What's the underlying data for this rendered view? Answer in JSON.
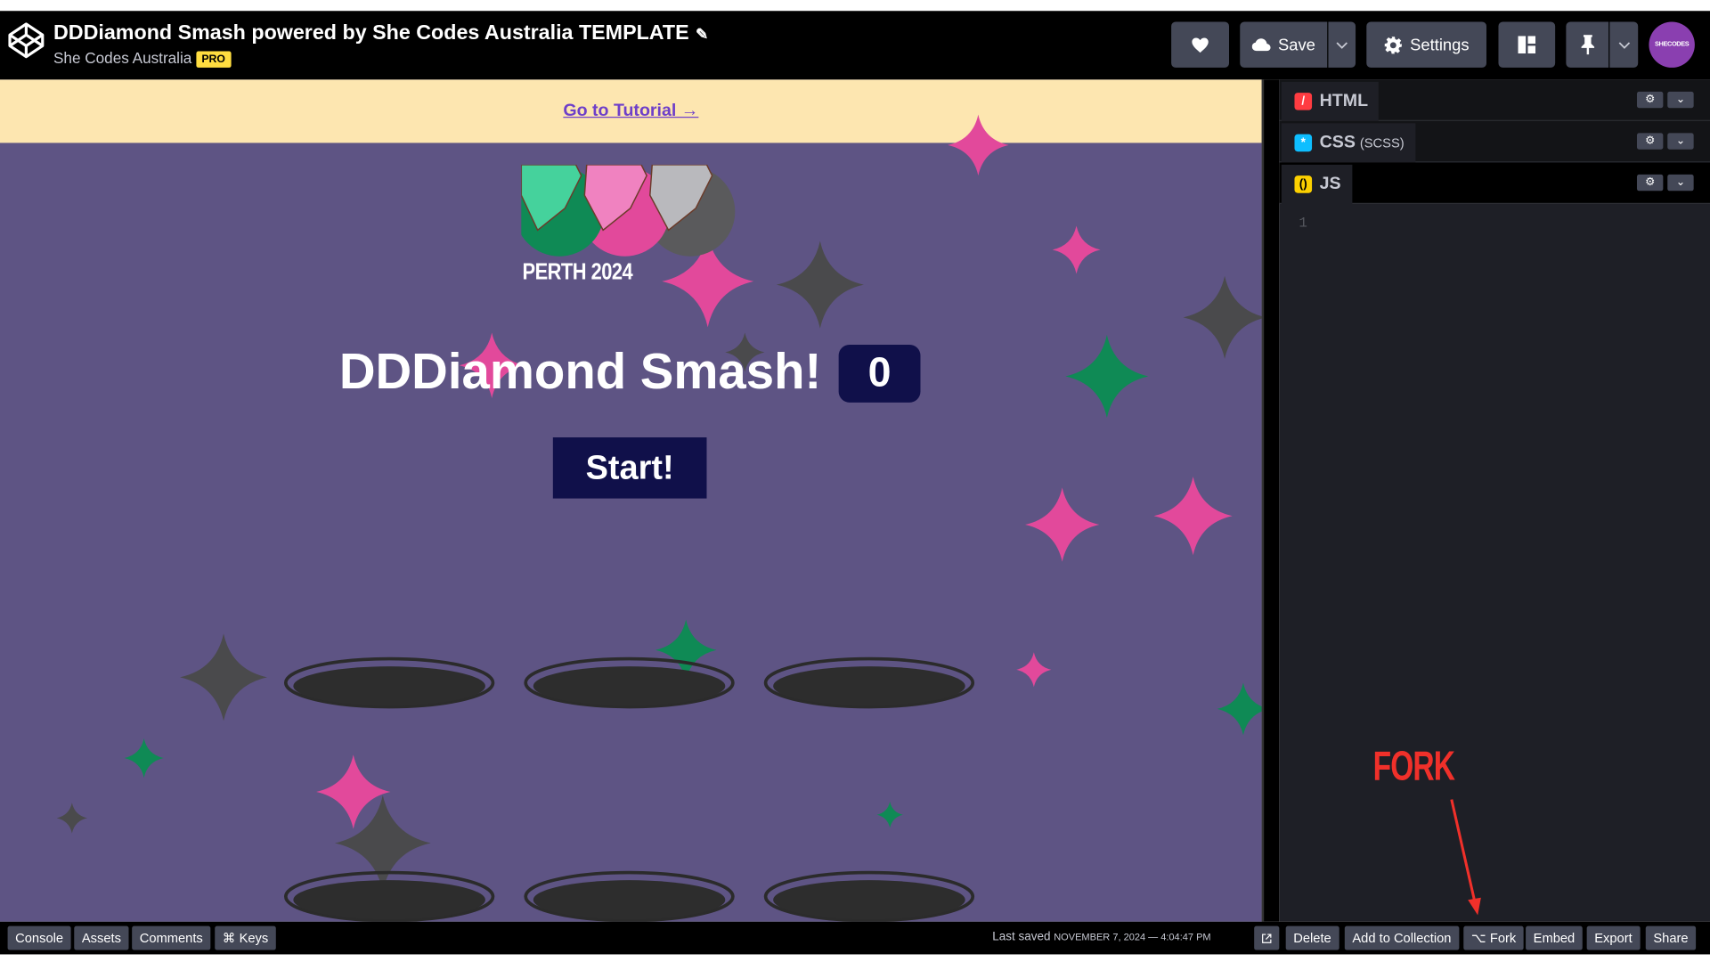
{
  "header": {
    "title": "DDDiamond Smash powered by She Codes Australia TEMPLATE",
    "owner": "She Codes Australia",
    "owner_badge": "PRO",
    "save_label": "Save",
    "settings_label": "Settings",
    "avatar_text": "SHECODES",
    "avatar_color": "#8a3fb0"
  },
  "preview": {
    "banner_link": "Go to Tutorial →",
    "event_label": "PERTH 2024",
    "game_title": "DDDiamond Smash!",
    "score": "0",
    "start_label": "Start!",
    "background_color": "#5e5484"
  },
  "editor": {
    "panes": [
      {
        "label": "HTML",
        "sublabel": "",
        "icon": "html-icon",
        "color": "#ff3c41"
      },
      {
        "label": "CSS",
        "sublabel": "(SCSS)",
        "icon": "css-icon",
        "color": "#0ebeff"
      },
      {
        "label": "JS",
        "sublabel": "",
        "icon": "js-icon",
        "color": "#fcd000"
      }
    ],
    "line_number": "1"
  },
  "annotation": {
    "text": "FORK",
    "color": "#f0302a"
  },
  "footer": {
    "left_buttons": [
      "Console",
      "Assets",
      "Comments",
      "⌘ Keys"
    ],
    "saved_prefix": "Last saved",
    "saved_time": "NOVEMBER 7, 2024 — 4:04:47 PM",
    "right_buttons": [
      "Delete",
      "Add to Collection",
      "⌥ Fork",
      "Embed",
      "Export",
      "Share"
    ]
  }
}
